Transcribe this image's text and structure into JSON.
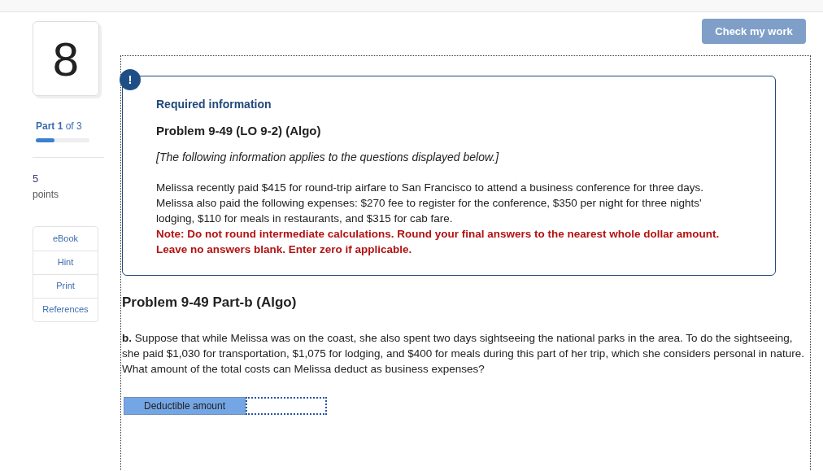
{
  "question_number": "8",
  "part": {
    "label": "**Part 1** of 3",
    "level": 0.35
  },
  "points": {
    "value": "5",
    "label": "points"
  },
  "tools": [
    {
      "label": "eBook"
    },
    {
      "label": "Hint"
    },
    {
      "label": "Print"
    },
    {
      "label": "References"
    }
  ],
  "check_button": {
    "label": "Check my work",
    "disabled": true
  },
  "required_info": {
    "icon": "!",
    "heading": "Required information",
    "title": "Problem 9-49 (LO 9-2) (Algo)",
    "note": "[The following information applies to the questions displayed below.]",
    "body": "Melissa recently paid $415 for round-trip airfare to San Francisco to attend a business conference for three days. Melissa also paid the following expenses: $270 fee to register for the conference, $350 per night for three nights' lodging, $110 for meals in restaurants, and $315 for cab fare.",
    "warning": "Note: Do not round intermediate calculations. Round your final answers to the nearest whole dollar amount. Leave no answers blank. Enter zero if applicable."
  },
  "part_title": "Problem 9-49 Part-b (Algo)",
  "question": "**b.** Suppose that while Melissa was on the coast, she also spent two days sightseeing the national parks in the area. To do the sightseeing, she paid $1,030 for transportation, $1,075 for lodging, and $400 for meals during this part of her trip, which she considers personal in nature. What amount of the total costs can Melissa deduct as business expenses?",
  "answer": {
    "label": "Deductible amount"
  }
}
